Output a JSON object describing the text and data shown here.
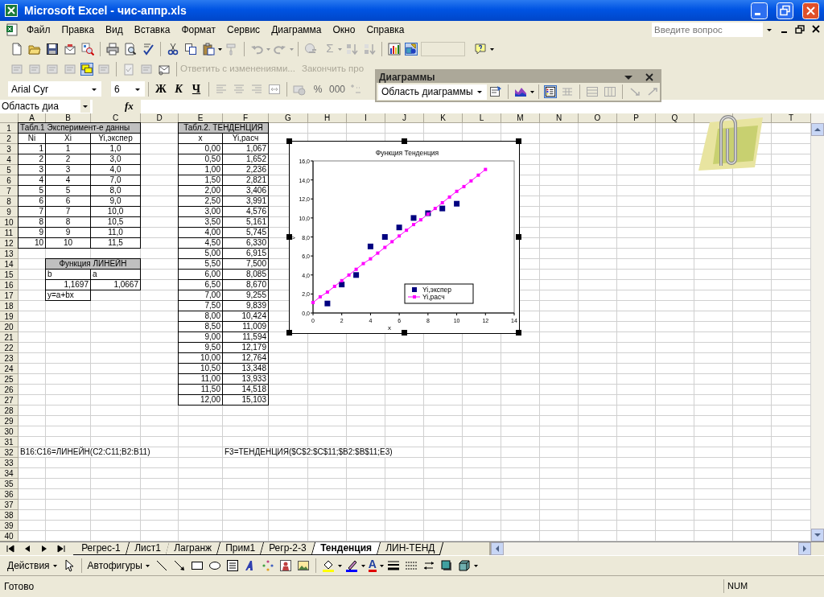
{
  "window": {
    "title": "Microsoft Excel - чис-аппр.xls"
  },
  "menu": {
    "items": [
      "Файл",
      "Правка",
      "Вид",
      "Вставка",
      "Формат",
      "Сервис",
      "Диаграмма",
      "Окно",
      "Справка"
    ],
    "help_box": {
      "placeholder": "Введите вопрос"
    }
  },
  "standard_toolbar": {
    "sum_glyph": "Σ",
    "drawing_on": true
  },
  "review_toolbar": {
    "comments_on": true,
    "commands": [
      {
        "label": "Ответить с изменениями...",
        "disabled": true
      },
      {
        "label": "Закончить про",
        "disabled": true
      }
    ]
  },
  "formatting_toolbar": {
    "font": "Arial Cyr",
    "size": "6",
    "style_buttons": [
      "Ж",
      "К",
      "Ч"
    ],
    "number_buttons": [
      "%",
      "000"
    ]
  },
  "charts_toolbar": {
    "title": "Диаграммы",
    "element": "Область диаграммы",
    "legend_on": true
  },
  "formula_bar": {
    "name_box": "Область диа",
    "fx": "fx"
  },
  "sheet": {
    "columns": [
      {
        "label": "A"
      },
      {
        "label": "B"
      },
      {
        "label": "C"
      },
      {
        "label": "D"
      },
      {
        "label": "E"
      },
      {
        "label": "F"
      },
      {
        "label": "G"
      },
      {
        "label": "H"
      },
      {
        "label": "I"
      },
      {
        "label": "J"
      },
      {
        "label": "K"
      },
      {
        "label": "L"
      },
      {
        "label": "M"
      },
      {
        "label": "N"
      },
      {
        "label": "O"
      },
      {
        "label": "P"
      },
      {
        "label": "Q"
      },
      {},
      {},
      {
        "label": "T"
      }
    ],
    "row_headers": [
      "1",
      "2",
      "3",
      "4",
      "5",
      "6",
      "7",
      "8",
      "9",
      "10",
      "11",
      "12",
      "13",
      "14",
      "15",
      "16",
      "17",
      "18",
      "19",
      "20",
      "21",
      "22",
      "23",
      "24",
      "25",
      "26",
      "27",
      "28",
      "29",
      "30",
      "31",
      "32",
      "33",
      "34",
      "35",
      "36",
      "37",
      "38",
      "39",
      "40"
    ],
    "table1": {
      "title": "Табл.1 Эксперимент-е данны",
      "columns": [
        "Ni",
        "Xi",
        "Yi,экспер"
      ],
      "rows": [
        [
          "1",
          "1",
          "1,0"
        ],
        [
          "2",
          "2",
          "3,0"
        ],
        [
          "3",
          "3",
          "4,0"
        ],
        [
          "4",
          "4",
          "7,0"
        ],
        [
          "5",
          "5",
          "8,0"
        ],
        [
          "6",
          "6",
          "9,0"
        ],
        [
          "7",
          "7",
          "10,0"
        ],
        [
          "8",
          "8",
          "10,5"
        ],
        [
          "9",
          "9",
          "11,0"
        ],
        [
          "10",
          "10",
          "11,5"
        ]
      ]
    },
    "linest": {
      "title": "Функция ЛИНЕЙН",
      "labels": [
        "b",
        "a"
      ],
      "values": [
        "1,1697",
        "1,0667"
      ],
      "formula": "y=a+bx"
    },
    "table2": {
      "title": "Табл.2. ТЕНДЕНЦИЯ",
      "columns": [
        "x",
        "Yi,расч"
      ],
      "rows": [
        [
          "0,00",
          "1,067"
        ],
        [
          "0,50",
          "1,652"
        ],
        [
          "1,00",
          "2,236"
        ],
        [
          "1,50",
          "2,821"
        ],
        [
          "2,00",
          "3,406"
        ],
        [
          "2,50",
          "3,991"
        ],
        [
          "3,00",
          "4,576"
        ],
        [
          "3,50",
          "5,161"
        ],
        [
          "4,00",
          "5,745"
        ],
        [
          "4,50",
          "6,330"
        ],
        [
          "5,00",
          "6,915"
        ],
        [
          "5,50",
          "7,500"
        ],
        [
          "6,00",
          "8,085"
        ],
        [
          "6,50",
          "8,670"
        ],
        [
          "7,00",
          "9,255"
        ],
        [
          "7,50",
          "9,839"
        ],
        [
          "8,00",
          "10,424"
        ],
        [
          "8,50",
          "11,009"
        ],
        [
          "9,00",
          "11,594"
        ],
        [
          "9,50",
          "12,179"
        ],
        [
          "10,00",
          "12,764"
        ],
        [
          "10,50",
          "13,348"
        ],
        [
          "11,00",
          "13,933"
        ],
        [
          "11,50",
          "14,518"
        ],
        [
          "12,00",
          "15,103"
        ]
      ]
    },
    "notes": [
      "B16:C16=ЛИНЕЙН(C2:C11;B2:B11)",
      "F3=ТЕНДЕНЦИЯ($C$2:$C$11;$B2:$B$11;E3)"
    ],
    "chart": {
      "chart_data": {
        "type": "scatter",
        "title": "Функция Тенденция",
        "xlabel": "x",
        "ylabel": ">",
        "x": [
          0,
          0.5,
          1,
          1.5,
          2,
          2.5,
          3,
          3.5,
          4,
          4.5,
          5,
          5.5,
          6,
          6.5,
          7,
          7.5,
          8,
          8.5,
          9,
          9.5,
          10,
          10.5,
          11,
          11.5,
          12
        ],
        "legend": "inside-bottom-right",
        "xlim": [
          0,
          14
        ],
        "ylim": [
          0,
          16
        ],
        "xticks": [
          0,
          2,
          4,
          6,
          8,
          10,
          12,
          14
        ],
        "yticks": [
          {
            "value": 0,
            "label": "0,0"
          },
          {
            "value": 2,
            "label": "2,0"
          },
          {
            "value": 4,
            "label": "4,0"
          },
          {
            "value": 6,
            "label": "6,0"
          },
          {
            "value": 8,
            "label": "8,0"
          },
          {
            "value": 10,
            "label": "10,0"
          },
          {
            "value": 12,
            "label": "12,0"
          },
          {
            "value": 14,
            "label": "14,0"
          },
          {
            "value": 16,
            "label": "16,0"
          }
        ],
        "series": [
          {
            "name": "Yi,экспер",
            "type": "scatter",
            "marker": "square",
            "color": "#000080",
            "values": [
              null,
              null,
              1,
              null,
              3,
              null,
              4,
              null,
              7,
              null,
              8,
              null,
              9,
              null,
              10,
              null,
              10.5,
              null,
              11,
              null,
              11.5,
              null,
              null,
              null,
              null
            ]
          },
          {
            "name": "Yi,расч",
            "type": "line",
            "marker": "square",
            "color": "#ff00ff",
            "values": [
              1.1,
              1.7,
              2.2,
              2.8,
              3.4,
              4.0,
              4.6,
              5.2,
              5.7,
              6.3,
              6.9,
              7.5,
              8.1,
              8.7,
              9.3,
              9.8,
              10.4,
              11.0,
              11.6,
              12.2,
              12.8,
              13.3,
              13.9,
              14.5,
              15.1
            ]
          }
        ]
      }
    }
  },
  "sheet_tabs": [
    {
      "label": "Регрес-1",
      "selected": false
    },
    {
      "label": "Лист1",
      "selected": false
    },
    {
      "label": "Лагранж",
      "selected": false
    },
    {
      "label": "Прим1",
      "selected": false
    },
    {
      "label": "Регр-2-3",
      "selected": false
    },
    {
      "label": "Тенденция",
      "selected": true
    },
    {
      "label": "ЛИН-ТЕНД",
      "selected": false
    }
  ],
  "drawing_toolbar": {
    "actions": "Действия",
    "autoshapes": "Автофигуры",
    "font_color_glyph": "A"
  },
  "status_bar": {
    "left": "Готово",
    "num": "NUM"
  }
}
